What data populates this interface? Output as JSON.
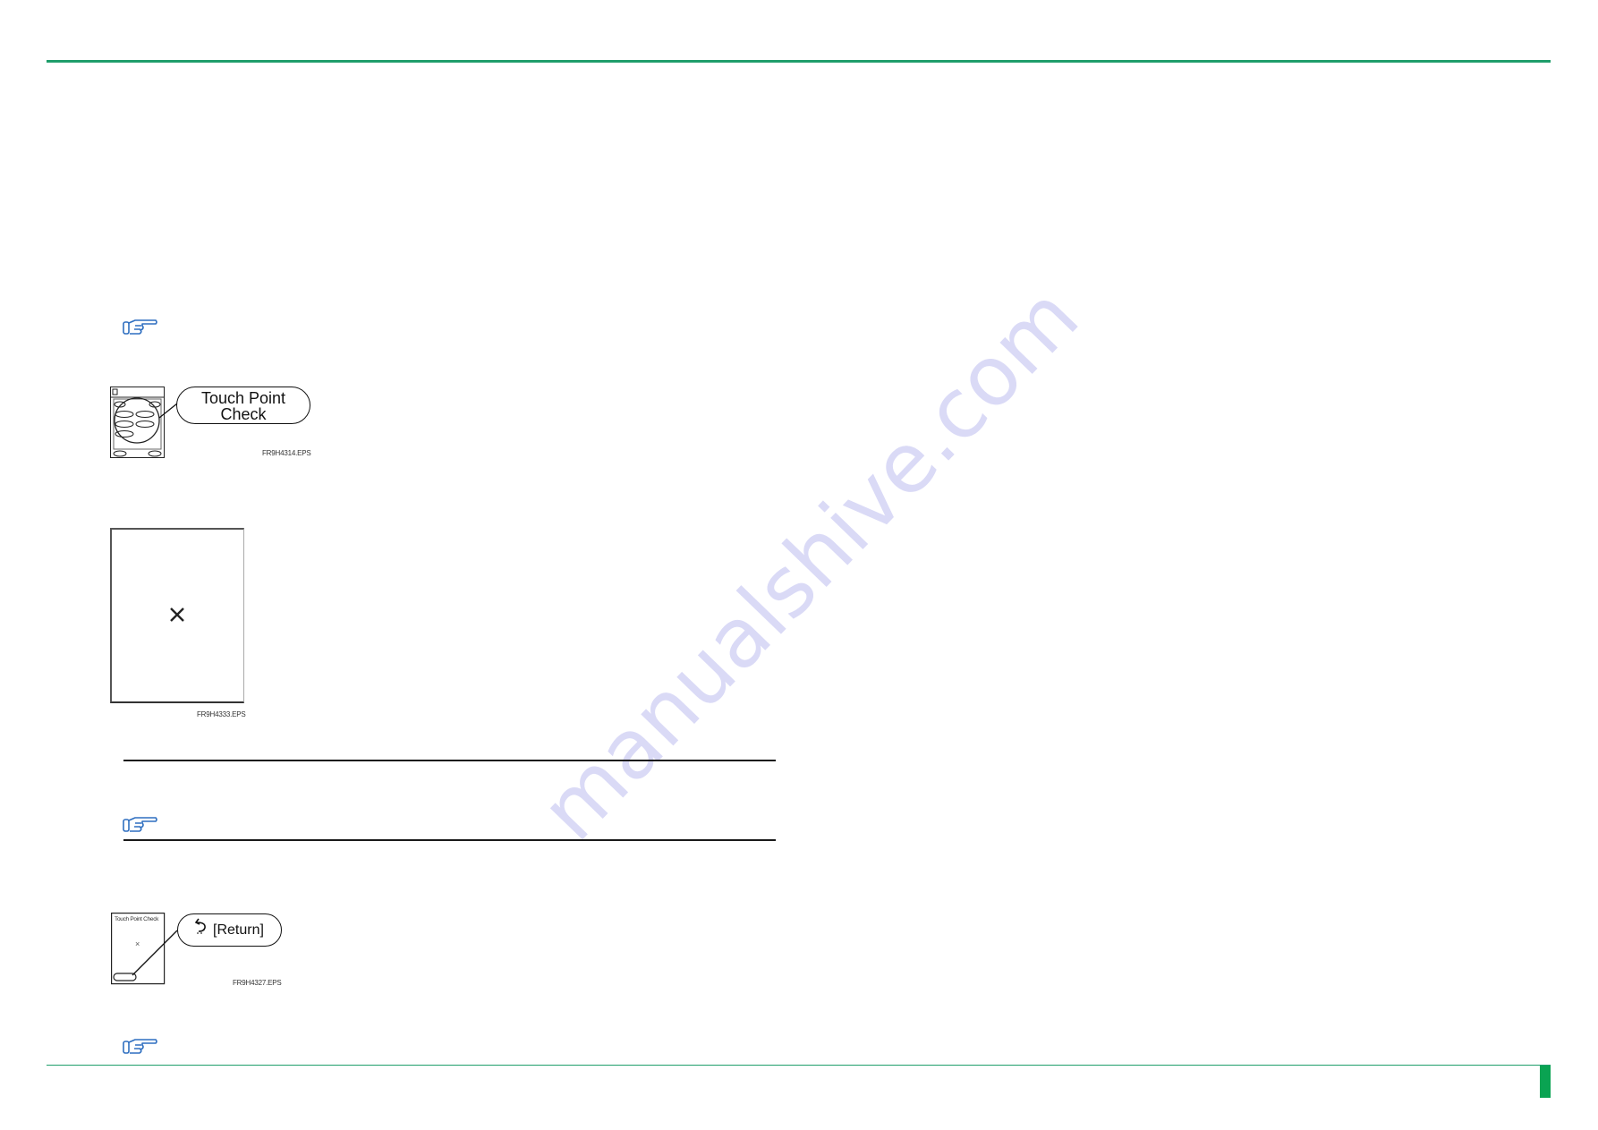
{
  "page": {
    "accent_color": "#1f9e6b",
    "tab_color": "#0aa352",
    "icon_color": "#2f6fc0"
  },
  "watermark": {
    "text": "manualshive.com"
  },
  "notes": [
    {
      "icon": "pointing-hand-icon"
    },
    {
      "icon": "pointing-hand-icon"
    },
    {
      "icon": "pointing-hand-icon"
    }
  ],
  "figures": [
    {
      "id": "touch-point-check-fig",
      "callout_line1": "Touch Point",
      "callout_line2": "Check",
      "label": "FR9H4314.EPS"
    },
    {
      "id": "touch-target-fig",
      "mark": "×",
      "label": "FR9H4333.EPS"
    },
    {
      "id": "return-fig",
      "screen_title": "Touch Point Check",
      "mark": "×",
      "callout": "[Return]",
      "callout_icon": "return-arrow-icon",
      "label": "FR9H4327.EPS"
    }
  ]
}
